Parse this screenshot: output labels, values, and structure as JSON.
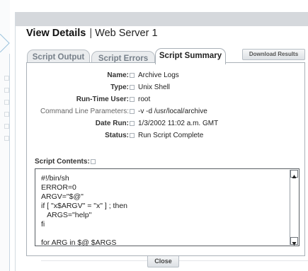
{
  "dialog": {
    "title": "View Details",
    "separator": "|",
    "subtitle": "Web Server 1"
  },
  "tabs": [
    {
      "label": "Script Output",
      "active": false
    },
    {
      "label": "Script Errors",
      "active": false
    },
    {
      "label": "Script Summary",
      "active": true
    }
  ],
  "download_label": "Download Results",
  "fields": [
    {
      "label": "Name:",
      "value": "Archive Logs"
    },
    {
      "label": "Type:",
      "value": "Unix Shell"
    },
    {
      "label": "Run-Time User:",
      "value": "root"
    },
    {
      "label": "Command Line Parameters:",
      "value": "-v -d /usr/local/archive"
    },
    {
      "label": "Date Run:",
      "value": "1/3/2002 11:02 a.m. GMT"
    },
    {
      "label": "Status:",
      "value": "Run Script Complete"
    }
  ],
  "contents_label": "Script Contents:",
  "script_lines": [
    "#!/bin/sh",
    "ERROR=0",
    "ARGV=\"$@\"",
    "if [ \"x$ARGV\" = \"x\" ] ; then",
    "   ARGS=\"help\"",
    "fi",
    "",
    "for ARG in $@ $ARGS"
  ],
  "close_label": "Close",
  "colors": {
    "header_bar": "#d5d8dc",
    "dialog_bg": "#eceff2",
    "accent_line": "#9cc3dd"
  }
}
